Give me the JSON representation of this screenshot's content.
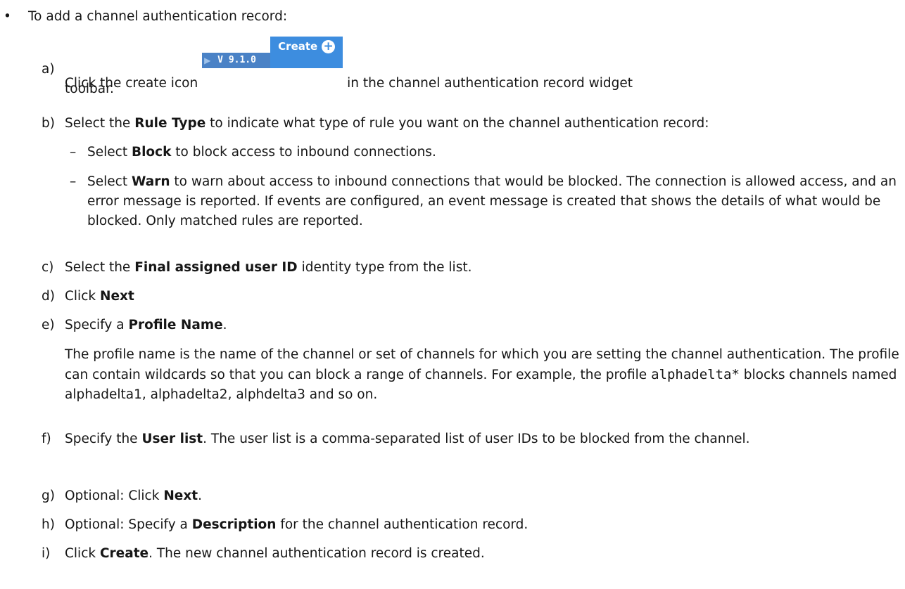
{
  "intro": {
    "bullet": "•",
    "text": "To add a channel authentication record:"
  },
  "create_icon": {
    "version": "V 9.1.0",
    "label": "Create",
    "icon": "plus-circle-icon"
  },
  "steps": {
    "a": {
      "label": "a)",
      "before": "Click the create icon",
      "after": "in the channel authentication record widget toolbar."
    },
    "b": {
      "label": "b)",
      "before": "Select the",
      "bold": "Rule Type",
      "after": "to indicate what type of rule you want on the channel authentication record:",
      "subs": [
        {
          "dash": "–",
          "before": "Select",
          "bold": "Block",
          "after": "to block access to inbound connections."
        },
        {
          "dash": "–",
          "before": "Select",
          "bold": "Warn",
          "after": "to warn about access to inbound connections that would be blocked. The connection is allowed access, and an error message is reported. If events are configured, an event message is created that shows the details of what would be blocked. Only matched rules are reported."
        }
      ]
    },
    "c": {
      "label": "c)",
      "before": "Select the",
      "bold": "Final assigned user ID",
      "after": "identity type from the list."
    },
    "d": {
      "label": "d)",
      "before": "Click",
      "bold": "Next"
    },
    "e": {
      "label": "e)",
      "before": "Specify a",
      "bold": "Profile Name",
      "after": ".",
      "para_before": "The profile name is the name of the channel or set of channels for which you are setting the channel authentication. The profile can contain wildcards so that you can block a range of channels. For example, the profile",
      "para_code": "alphadelta*",
      "para_after": "blocks channels named alphadelta1, alphadelta2, alphdelta3 and so on."
    },
    "f": {
      "label": "f)",
      "before": "Specify the",
      "bold": "User list",
      "after": ". The user list is a comma-separated list of user IDs to be blocked from the channel."
    },
    "g": {
      "label": "g)",
      "before": "Optional: Click",
      "bold": "Next",
      "after": "."
    },
    "h": {
      "label": "h)",
      "before": "Optional: Specify a",
      "bold": "Description",
      "after": "for the channel authentication record."
    },
    "i": {
      "label": "i)",
      "before": "Click",
      "bold": "Create",
      "after": ". The new channel authentication record is created."
    }
  }
}
